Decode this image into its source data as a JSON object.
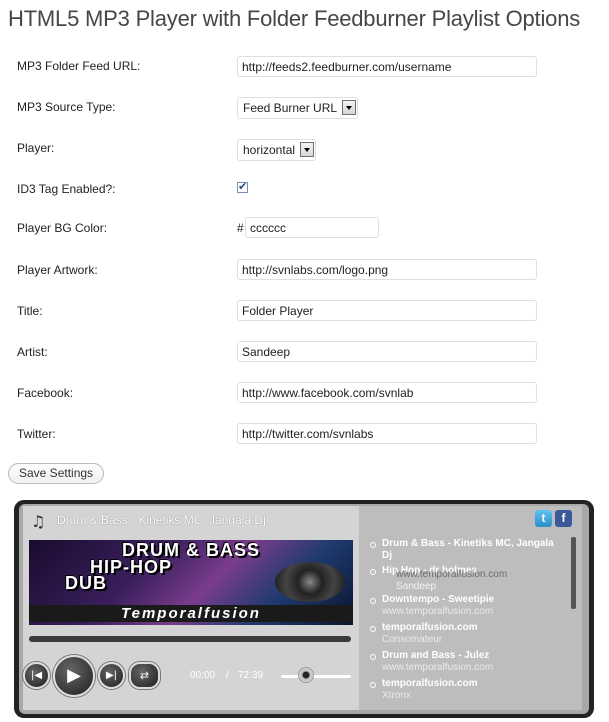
{
  "page": {
    "title": "HTML5 MP3 Player with Folder Feedburner Playlist Options"
  },
  "form": {
    "feed_url": {
      "label": "MP3 Folder Feed URL:",
      "value": "http://feeds2.feedburner.com/username"
    },
    "source_type": {
      "label": "MP3 Source Type:",
      "value": "Feed Burner URL"
    },
    "player": {
      "label": "Player:",
      "value": "horizontal"
    },
    "id3": {
      "label": "ID3 Tag Enabled?:",
      "checked": true
    },
    "bg_color": {
      "label": "Player BG Color:",
      "prefix": "#",
      "value": "cccccc"
    },
    "artwork": {
      "label": "Player Artwork:",
      "value": "http://svnlabs.com/logo.png"
    },
    "title": {
      "label": "Title:",
      "value": "Folder Player"
    },
    "artist": {
      "label": "Artist:",
      "value": "Sandeep"
    },
    "facebook": {
      "label": "Facebook:",
      "value": "http://www.facebook.com/svnlab"
    },
    "twitter": {
      "label": "Twitter:",
      "value": "http://twitter.com/svnlabs"
    },
    "save_label": "Save Settings"
  },
  "player": {
    "now_playing": "Drum & Bass - Kinetiks MC, Jangala Dj",
    "artwork_text": {
      "line1": "DRUM & BASS",
      "line2": "HIP-HOP",
      "line3": "DUB",
      "brand": "Temporalfusion"
    },
    "current_time": "00:00",
    "separator": "/",
    "duration": "72:39",
    "prev_glyph": "|◀",
    "play_glyph": "▶",
    "next_glyph": "▶|",
    "shuffle_glyph": "⇄",
    "note_glyph": "♫",
    "twitter_glyph": "t",
    "facebook_glyph": "f",
    "volume_fraction": 0.35,
    "playlist": [
      {
        "title": "Drum & Bass - Kinetiks MC, Jangala Dj",
        "sub": ""
      },
      {
        "title": "Hip Hop - dr holmes",
        "sub": "www.temporalfusion.com"
      },
      {
        "title": "",
        "sub": "Sandeep"
      },
      {
        "title": "Downtempo - Sweetipie",
        "sub": "www.temporalfusion.com"
      },
      {
        "title": "temporalfusion.com",
        "sub": "Consomateur"
      },
      {
        "title": "Drum and Bass - Julez",
        "sub": "www.temporalfusion.com"
      },
      {
        "title": "temporalfusion.com",
        "sub": "Xtronx"
      }
    ]
  }
}
